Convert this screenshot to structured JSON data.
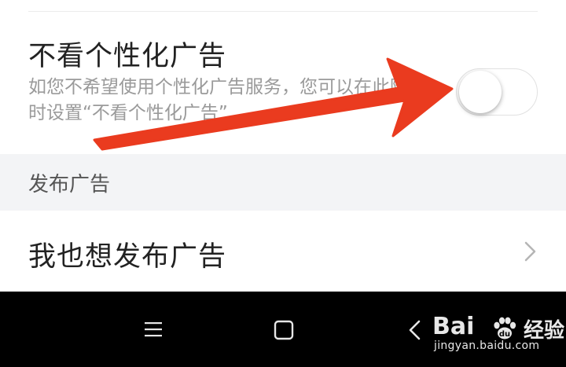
{
  "personalized_ads": {
    "title": "不看个性化广告",
    "description": "如您不希望使用个性化广告服务，您可以在此随时设置“不看个性化广告”",
    "toggle_state": "off"
  },
  "publish_section": {
    "header": "发布广告",
    "item_label": "我也想发布广告"
  },
  "annotation": {
    "arrow_color": "#ea3b1f"
  },
  "system_nav": {
    "menu_icon": "menu-icon",
    "home_icon": "home-icon",
    "back_icon": "back-icon"
  },
  "watermark": {
    "logo": "Bai",
    "logo_suffix": "du",
    "text": "经验",
    "url": "jingyan.baidu.com"
  }
}
